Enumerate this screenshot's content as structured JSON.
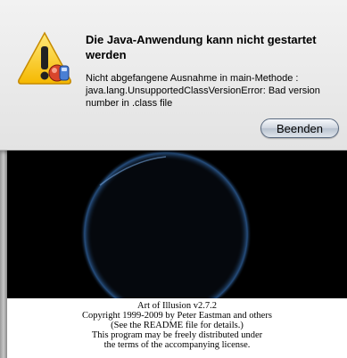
{
  "alert": {
    "title": "Die Java-Anwendung kann nicht gestartet werden",
    "message": "Nicht abgefangene Ausnahme in main-Methode : java.lang.UnsupportedClassVersionError: Bad version number in .class file",
    "quit_button_label": "Beenden",
    "icon": "warning-java-icon"
  },
  "splash": {
    "credits": [
      "Art of Illusion v2.7.2",
      "Copyright 1999-2009 by Peter Eastman and others",
      "(See the README file for details.)",
      "This program may be freely distributed under",
      "the terms of the accompanying license."
    ]
  }
}
